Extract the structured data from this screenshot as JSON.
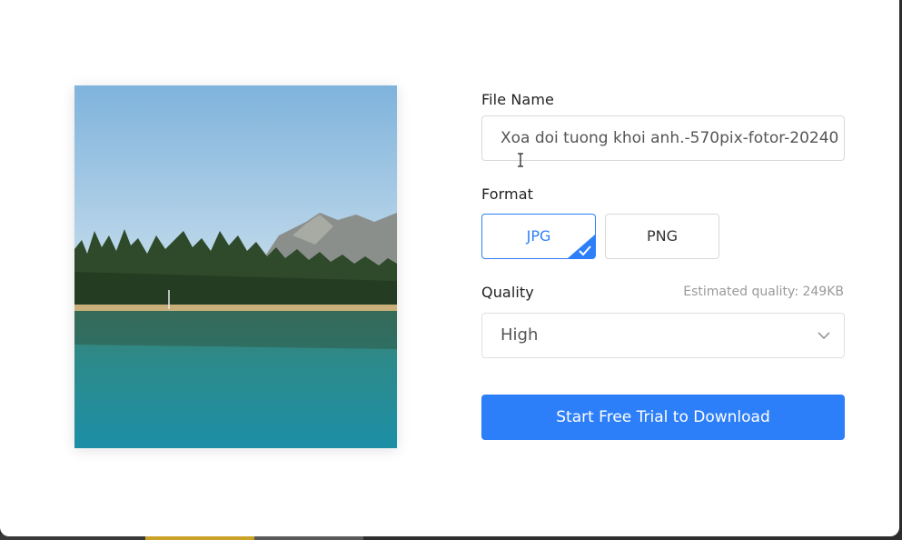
{
  "form": {
    "file_name_label": "File Name",
    "file_name_value": "Xoa doi tuong khoi anh.-570pix-fotor-20240",
    "format_label": "Format",
    "formats": [
      {
        "label": "JPG",
        "selected": true
      },
      {
        "label": "PNG",
        "selected": false
      }
    ],
    "quality_label": "Quality",
    "estimated_quality": "Estimated quality: 249KB",
    "quality_value": "High",
    "download_label": "Start Free Trial to Download"
  },
  "colors": {
    "accent": "#2d7ff9",
    "border": "#d9d9d9",
    "muted_text": "#9a9a9a"
  },
  "icons": {
    "selected_check": "check-icon",
    "dropdown": "chevron-down-icon",
    "text_cursor": "text-cursor-icon"
  }
}
